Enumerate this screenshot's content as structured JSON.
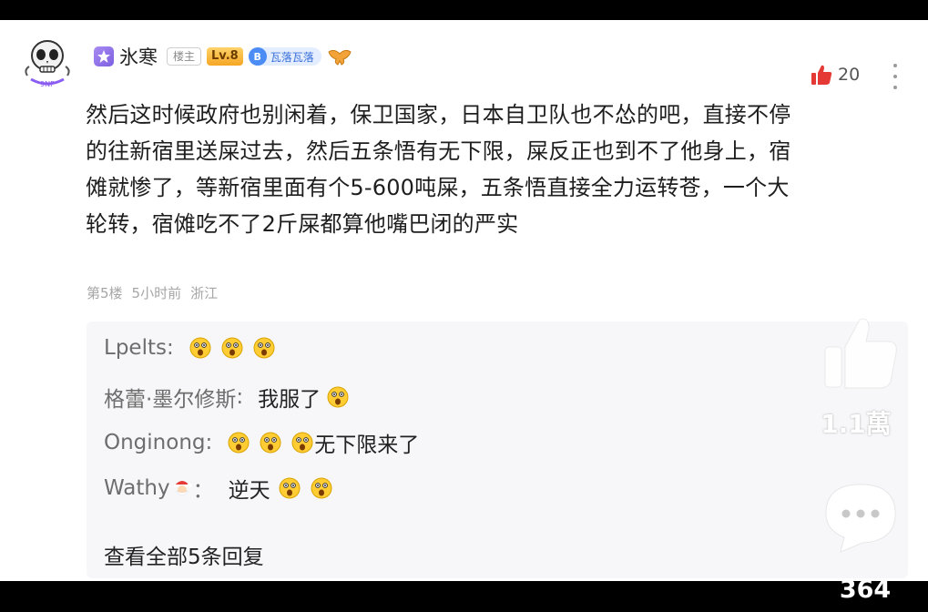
{
  "post": {
    "username": "氷寒",
    "tag_lz": "楼主",
    "level": "Lv.8",
    "fan_badge_letter": "B",
    "fan_badge_text": "瓦落瓦落",
    "like_count": "20",
    "comment_lines": [
      "然后这时候政府也别闲着，保卫国家，日本自卫队也不怂的吧，直接不停",
      "的往新宿里送屎过去，然后五条悟有无下限，屎反正也到不了他身上，宿",
      "傩就惨了，等新宿里面有个5-600吨屎，五条悟直接全力运转苍，一个大",
      "轮转，宿傩吃不了2斤屎都算他嘴巴闭的严实"
    ],
    "floor": "第5楼",
    "time": "5小时前",
    "location": "浙江"
  },
  "replies": [
    {
      "name": "Lpelts",
      "separator": ":",
      "text": ""
    },
    {
      "name": "格蕾·墨尔修斯",
      "separator": ":",
      "text": "我服了"
    },
    {
      "name": "Onginong",
      "separator": ":",
      "text": "无下限来了"
    },
    {
      "name": "Wathy",
      "separator": "：",
      "text": "逆天"
    }
  ],
  "view_all": "查看全部5条回复",
  "side": {
    "like_count": "1.1萬",
    "comment_count": "364"
  },
  "icons": {
    "avatar": "skull-avatar-icon",
    "like": "thumbs-up-icon",
    "emoji": "shocked-face-icon",
    "comment": "speech-bubble-icon"
  },
  "colors": {
    "like_red": "#e53935",
    "level_gold": "#f5a623",
    "fan_blue": "#4c8df5",
    "reply_bg": "#f7f7f9"
  }
}
